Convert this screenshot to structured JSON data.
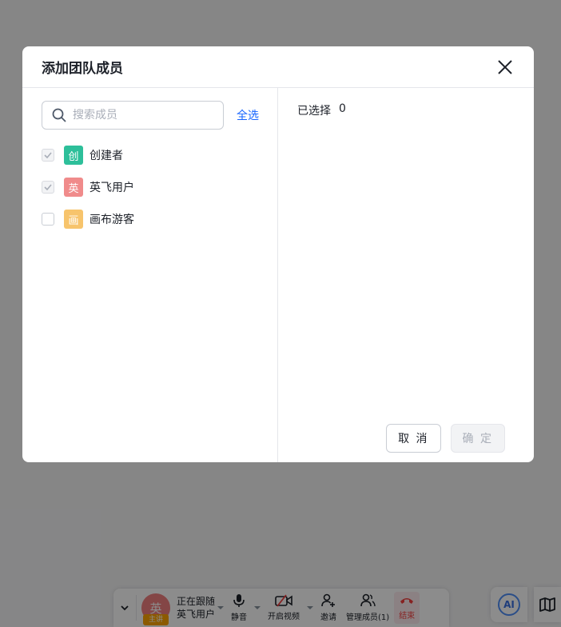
{
  "modal": {
    "title": "添加团队成员",
    "search_placeholder": "搜索成员",
    "select_all_label": "全选",
    "members": [
      {
        "initial": "创",
        "name": "创建者",
        "avatar_color": "#2dbf9a",
        "checked": true,
        "disabled": true
      },
      {
        "initial": "英",
        "name": "英飞用户",
        "avatar_color": "#f08b8b",
        "checked": true,
        "disabled": true
      },
      {
        "initial": "画",
        "name": "画布游客",
        "avatar_color": "#f7c46c",
        "checked": false,
        "disabled": false
      }
    ],
    "selected_label": "已选择",
    "selected_count": "0",
    "cancel_label": "取 消",
    "confirm_label": "确 定"
  },
  "toolbar": {
    "presenter": {
      "avatar_initial": "英",
      "host_badge": "主讲",
      "status": "正在跟随",
      "name": "英飞用户"
    },
    "mute_label": "静音",
    "video_label": "开启视频",
    "invite_label": "邀请",
    "manage_label": "管理成员(1)",
    "end_label": "结束"
  },
  "side": {
    "ai_label": "AI"
  },
  "colors": {
    "accent": "#1664ff",
    "end_red": "#f53f3f",
    "host_badge": "#ffa500"
  }
}
